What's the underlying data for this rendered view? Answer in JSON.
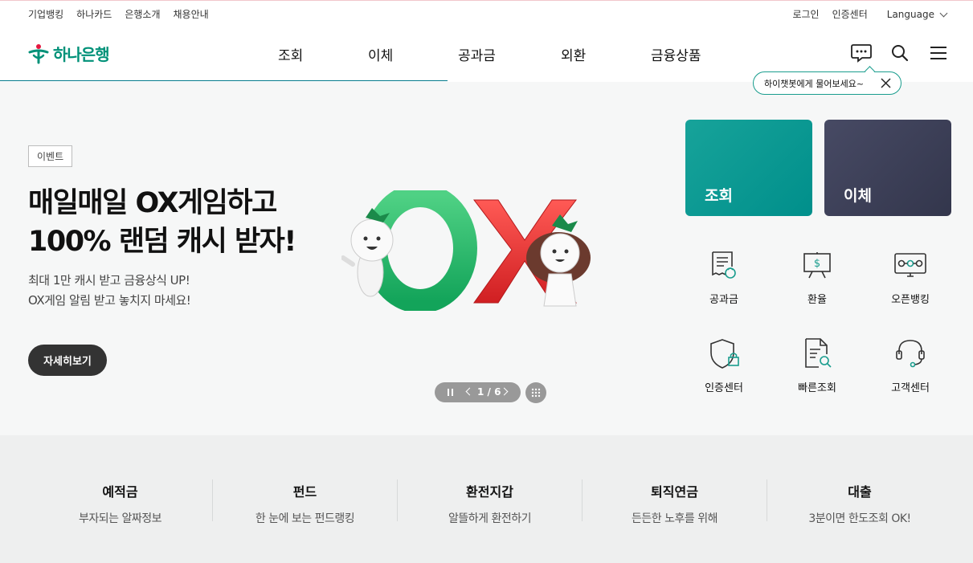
{
  "util": {
    "left_links": [
      "기업뱅킹",
      "하나카드",
      "은행소개",
      "채용안내"
    ],
    "login": "로그인",
    "cert_center": "인증센터",
    "language": "Language"
  },
  "gnb": {
    "logo_text": "하나은행",
    "menu": [
      "조회",
      "이체",
      "공과금",
      "외환",
      "금융상품"
    ],
    "icons": [
      "chatbot-icon",
      "search-icon",
      "hamburger-menu-icon"
    ]
  },
  "chatbot_bubble": {
    "text": "하이챗봇에게 물어보세요~"
  },
  "hero": {
    "tag": "이벤트",
    "title_line1": "매일매일 OX게임하고",
    "title_line2": "100% 랜덤 캐시 받자!",
    "sub_line1": "최대 1만 캐시 받고 금융상식 UP!",
    "sub_line2": "OX게임 알림 받고 놓치지 마세요!",
    "cta": "자세히보기",
    "pager": "1 / 6"
  },
  "quick": {
    "cards": [
      {
        "label": "조회",
        "color": "#0f9c95"
      },
      {
        "label": "이체",
        "color": "#3b3e56"
      }
    ],
    "icons": [
      {
        "label": "공과금",
        "icon": "bill-icon"
      },
      {
        "label": "환율",
        "icon": "exchange-rate-board-icon"
      },
      {
        "label": "오픈뱅킹",
        "icon": "open-banking-icon"
      },
      {
        "label": "인증센터",
        "icon": "shield-lock-icon"
      },
      {
        "label": "빠른조회",
        "icon": "document-search-icon"
      },
      {
        "label": "고객센터",
        "icon": "headset-icon"
      }
    ]
  },
  "strip": [
    {
      "title": "예적금",
      "desc": "부자되는 알짜정보"
    },
    {
      "title": "펀드",
      "desc": "한 눈에 보는 펀드랭킹"
    },
    {
      "title": "환전지갑",
      "desc": "알뜰하게 환전하기"
    },
    {
      "title": "퇴직연금",
      "desc": "든든한 노후를 위해"
    },
    {
      "title": "대출",
      "desc": "3분이면 한도조회 OK!"
    }
  ],
  "colors": {
    "brand": "#009178",
    "accent_teal": "#1a9d8e",
    "navy": "#3b3e56"
  }
}
